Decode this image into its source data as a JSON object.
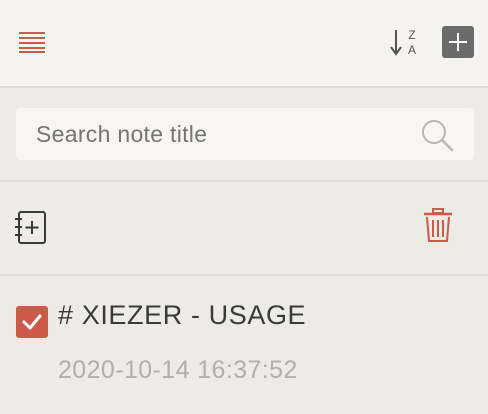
{
  "header": {
    "menu_icon": "hamburger-menu-icon",
    "sort_icon": "sort-z-a-icon",
    "sort_label_top": "Z",
    "sort_label_bottom": "A",
    "add_icon": "plus-icon"
  },
  "search": {
    "placeholder": "Search note title",
    "value": "",
    "icon": "search-icon"
  },
  "toolbar": {
    "new_notebook_icon": "notebook-add-icon",
    "trash_icon": "trash-icon"
  },
  "notes": [
    {
      "title": "# XIEZER - USAGE",
      "date": "2020-10-14 16:37:52",
      "checked": true
    }
  ],
  "colors": {
    "accent": "#cc5a4a",
    "background": "#ecebe5",
    "header_background": "#f5f4f0",
    "add_button": "#6b6b6b",
    "text_primary": "#3a3a36",
    "text_muted": "#b0afa8"
  }
}
